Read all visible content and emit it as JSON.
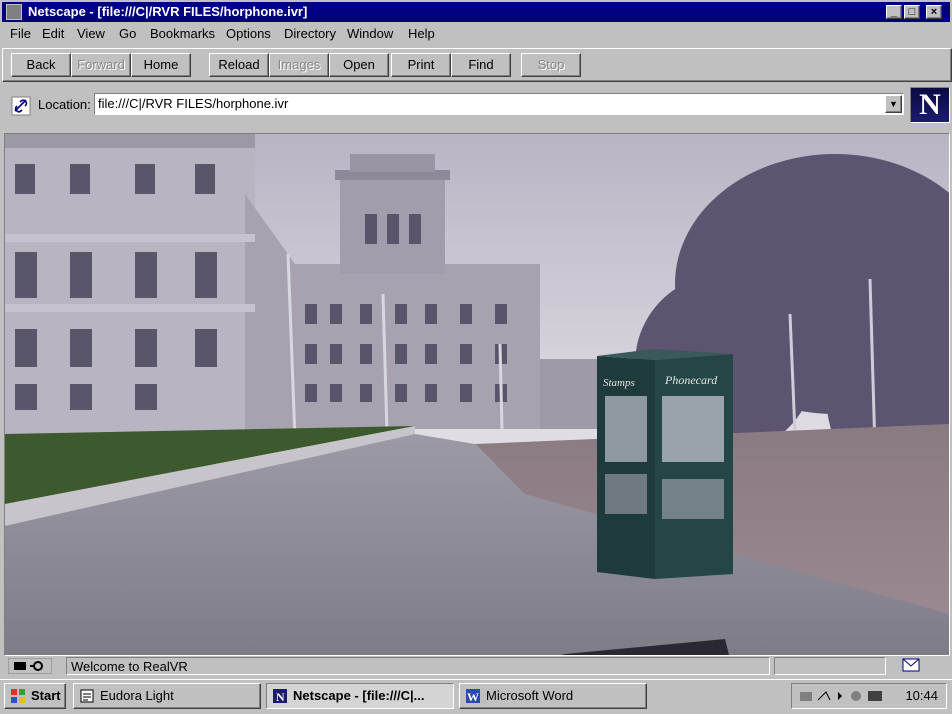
{
  "window": {
    "title": "Netscape - [file:///C|/RVR FILES/horphone.ivr]",
    "controls": [
      "_",
      "□",
      "×"
    ]
  },
  "menu": [
    "File",
    "Edit",
    "View",
    "Go",
    "Bookmarks",
    "Options",
    "Directory",
    "Window",
    "Help"
  ],
  "toolbar": {
    "back": "Back",
    "forward": "Forward",
    "home": "Home",
    "reload": "Reload",
    "images": "Images",
    "open": "Open",
    "print": "Print",
    "find": "Find",
    "stop": "Stop"
  },
  "location": {
    "label": "Location:",
    "value": "file:///C|/RVR FILES/horphone.ivr",
    "logo": "N"
  },
  "scene": {
    "kiosk_sign_left": "Stamps",
    "kiosk_sign_right": "Phonecard"
  },
  "status": {
    "text": "Welcome to RealVR"
  },
  "taskbar": {
    "start": "Start",
    "tasks": [
      "Eudora Light",
      "Netscape - [file:///C|...",
      "Microsoft Word"
    ],
    "clock": "10:44"
  },
  "colors": {
    "titlebar": "#000080",
    "chrome": "#c0c0c0",
    "kiosk": "#1f3a3a"
  }
}
